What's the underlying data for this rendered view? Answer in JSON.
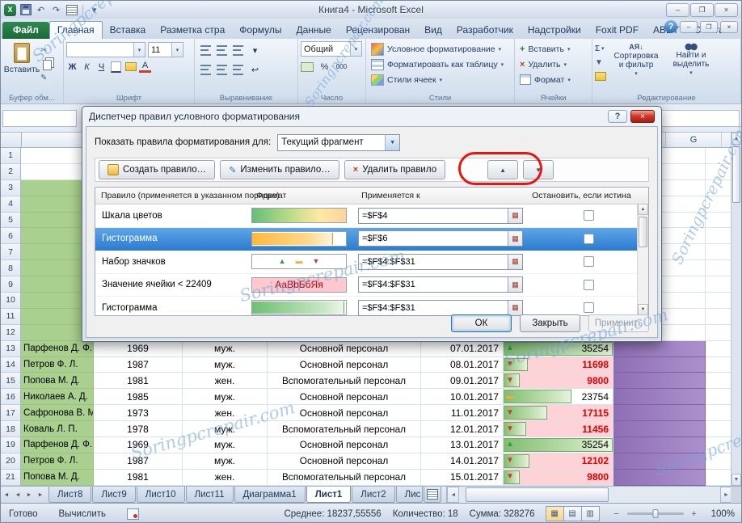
{
  "watermark": "Soringpcrepair.com",
  "title_bar": {
    "title": "Книга4 - Microsoft Excel"
  },
  "ribbon_tabs": [
    "Файл",
    "Главная",
    "Вставка",
    "Разметка стра",
    "Формулы",
    "Данные",
    "Рецензирован",
    "Вид",
    "Разработчик",
    "Надстройки",
    "Foxit PDF",
    "ABBYY PDF Trar"
  ],
  "ribbon": {
    "clipboard": {
      "label": "Буфер обм...",
      "paste": "Вставить"
    },
    "font": {
      "label": "Шрифт",
      "size": "11",
      "bold": "Ж",
      "italic": "К",
      "underline": "Ч"
    },
    "alignment": {
      "label": "Выравнивание"
    },
    "number": {
      "label": "Число",
      "format": "Общий",
      "percent": "%",
      "thousands": "000"
    },
    "styles": {
      "label": "Стили",
      "conditional": "Условное форматирование",
      "as_table": "Форматировать как таблицу",
      "cell_styles": "Стили ячеек"
    },
    "cells": {
      "label": "Ячейки",
      "insert": "Вставить",
      "delete": "Удалить",
      "format": "Формат"
    },
    "editing": {
      "label": "Редактирование",
      "sigma": "Σ",
      "sort": "Сортировка и фильтр",
      "find": "Найти и выделить"
    }
  },
  "dialog": {
    "title": "Диспетчер правил условного форматирования",
    "show_rules_label": "Показать правила форматирования для:",
    "scope_value": "Текущий фрагмент",
    "buttons": {
      "create": "Создать правило…",
      "edit": "Изменить правило…",
      "delete": "Удалить правило"
    },
    "columns": [
      "Правило (применяется в указанном порядке)",
      "Формат",
      "Применяется к",
      "Остановить, если истина"
    ],
    "rules": [
      {
        "name": "Шкала цветов",
        "format_type": "color-scale",
        "applies_to": "=$F$4",
        "selected": false
      },
      {
        "name": "Гистограмма",
        "format_type": "data-bar-orange",
        "applies_to": "=$F$6",
        "selected": true
      },
      {
        "name": "Набор значков",
        "format_type": "icon-set",
        "applies_to": "=$F$4:$F$31",
        "selected": false
      },
      {
        "name": "Значение ячейки < 22409",
        "format_type": "text-sample",
        "format_text": "АаВbБбЯя",
        "applies_to": "=$F$4:$F$31",
        "selected": false
      },
      {
        "name": "Гистограмма",
        "format_type": "data-bar-green",
        "applies_to": "=$F$4:$F$31",
        "selected": false
      }
    ],
    "footer": {
      "ok": "ОК",
      "close": "Закрыть",
      "apply": "Применить"
    }
  },
  "sheet": {
    "visible_col_header": "G",
    "row_count": 21,
    "rows": [
      {
        "num": 13,
        "name": "Парфенов Д. Ф.",
        "year": "1969",
        "sex": "муж.",
        "dept": "Основной персонал",
        "date": "07.01.2017",
        "value": "35254",
        "icon": "up",
        "bar": 100,
        "low": false
      },
      {
        "num": 14,
        "name": "Петров Ф. Л.",
        "year": "1987",
        "sex": "муж.",
        "dept": "Основной персонал",
        "date": "08.01.2017",
        "value": "11698",
        "icon": "down",
        "bar": 22,
        "low": true
      },
      {
        "num": 15,
        "name": "Попова М. Д.",
        "year": "1981",
        "sex": "жен.",
        "dept": "Вспомогательный персонал",
        "date": "09.01.2017",
        "value": "9800",
        "icon": "down",
        "bar": 15,
        "low": true
      },
      {
        "num": 16,
        "name": "Николаев А. Д.",
        "year": "1985",
        "sex": "муж.",
        "dept": "Основной персонал",
        "date": "10.01.2017",
        "value": "23754",
        "icon": "dash",
        "bar": 62,
        "low": false
      },
      {
        "num": 17,
        "name": "Сафронова В. М.",
        "year": "1973",
        "sex": "жен.",
        "dept": "Основной персонал",
        "date": "11.01.2017",
        "value": "17115",
        "icon": "down",
        "bar": 40,
        "low": true
      },
      {
        "num": 18,
        "name": "Коваль Л. П.",
        "year": "1978",
        "sex": "муж.",
        "dept": "Вспомогательный персонал",
        "date": "12.01.2017",
        "value": "11456",
        "icon": "down",
        "bar": 21,
        "low": true
      },
      {
        "num": 19,
        "name": "Парфенов Д. Ф.",
        "year": "1969",
        "sex": "муж.",
        "dept": "Основной персонал",
        "date": "13.01.2017",
        "value": "35254",
        "icon": "up",
        "bar": 100,
        "low": false
      },
      {
        "num": 20,
        "name": "Петров Ф. Л.",
        "year": "1987",
        "sex": "муж.",
        "dept": "Основной персонал",
        "date": "14.01.2017",
        "value": "12102",
        "icon": "down",
        "bar": 24,
        "low": true
      },
      {
        "num": 21,
        "name": "Попова М. Д.",
        "year": "1981",
        "sex": "жен.",
        "dept": "Вспомогательный персонал",
        "date": "15.01.2017",
        "value": "9800",
        "icon": "down",
        "bar": 15,
        "low": true
      }
    ]
  },
  "sheet_tabs": {
    "tabs": [
      "Лист8",
      "Лист9",
      "Лист10",
      "Лист11",
      "Диаграмма1",
      "Лист1",
      "Лист2",
      "Лис"
    ],
    "active": "Лист1"
  },
  "status_bar": {
    "ready": "Готово",
    "calculate": "Вычислить",
    "average": "Среднее: 18237,55556",
    "count": "Количество: 18",
    "sum": "Сумма: 328276",
    "zoom": "100%"
  },
  "icons": {
    "up": "▲",
    "down": "▼",
    "dash": "▬",
    "dropdown": "▼",
    "small_down": "▾",
    "scissors": "✂",
    "undo": "↶",
    "redo": "↷",
    "help": "?",
    "close": "×",
    "min": "–",
    "max": "❐",
    "sigma": "Σ",
    "left": "◄",
    "right": "►",
    "wrap": "↩",
    "pencil": "✎"
  }
}
